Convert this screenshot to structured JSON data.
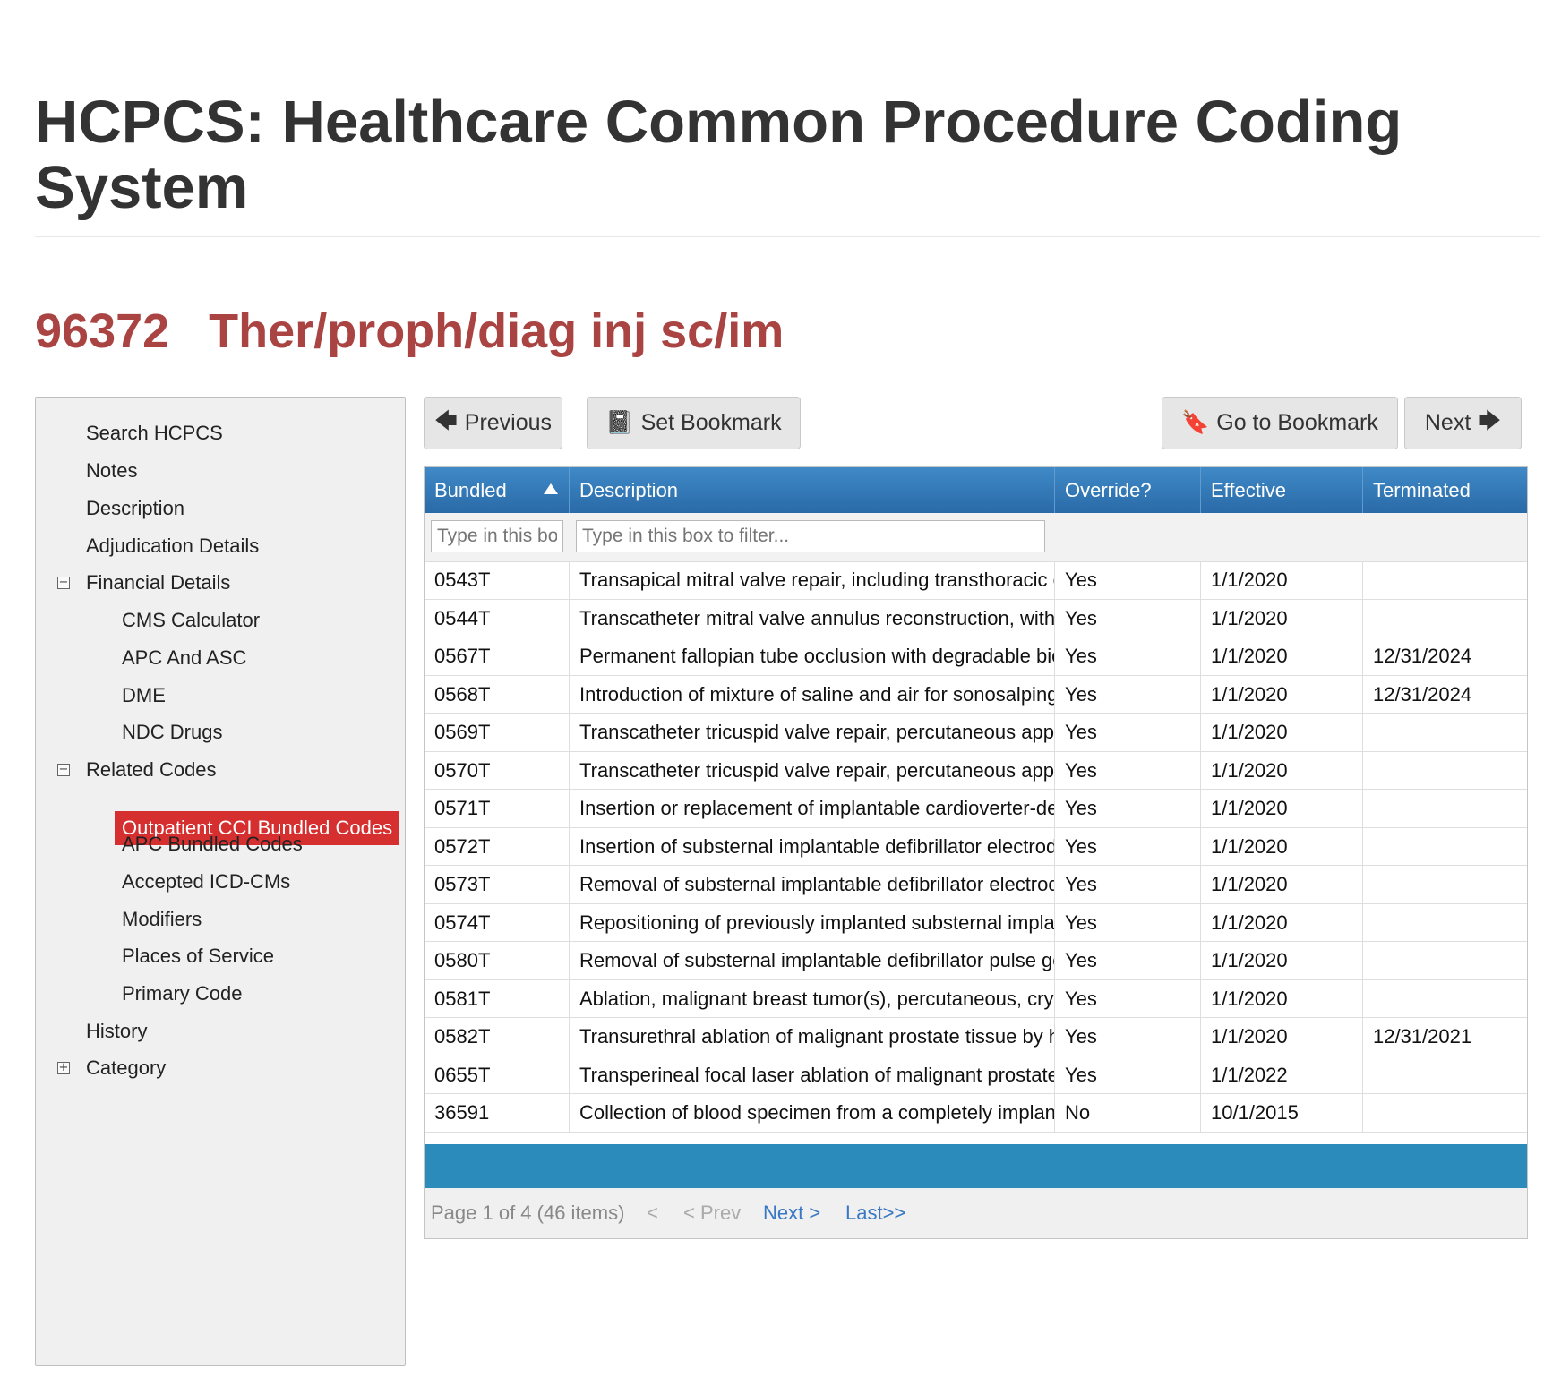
{
  "page": {
    "title": "HCPCS: Healthcare Common Procedure Coding System",
    "code": "96372",
    "code_desc": "Ther/proph/diag inj sc/im"
  },
  "sidebar": {
    "search": "Search HCPCS",
    "notes": "Notes",
    "description": "Description",
    "adjudication": "Adjudication Details",
    "financial": "Financial Details",
    "cms_calc": "CMS Calculator",
    "apc_asc": "APC And ASC",
    "dme": "DME",
    "ndc": "NDC Drugs",
    "related": "Related Codes",
    "outpatient_cci": "Outpatient CCI Bundled Codes",
    "apc_bundled": "APC Bundled Codes",
    "icd": "Accepted ICD-CMs",
    "modifiers": "Modifiers",
    "places": "Places of Service",
    "primary": "Primary Code",
    "history": "History",
    "category": "Category",
    "collapse_symbol": "−",
    "expand_symbol": "+"
  },
  "toolbar": {
    "previous": "Previous",
    "set_bookmark": "Set Bookmark",
    "go_bookmark": "Go to Bookmark",
    "next": "Next",
    "icons": {
      "arrow_left": "🡄",
      "book": "📓",
      "bookmark": "🔖",
      "arrow_right": "🡆"
    }
  },
  "grid": {
    "columns": [
      "Bundled",
      "Description",
      "Override?",
      "Effective",
      "Terminated"
    ],
    "filter_placeholder_bundled": "Type in this box to filter...",
    "filter_placeholder_desc": "Type in this box to filter...",
    "rows": [
      [
        "0543T",
        "Transapical mitral valve repair, including transthoracic echocardiography",
        "Yes",
        "1/1/2020",
        ""
      ],
      [
        "0544T",
        "Transcatheter mitral valve annulus reconstruction, with implantation",
        "Yes",
        "1/1/2020",
        ""
      ],
      [
        "0567T",
        "Permanent fallopian tube occlusion with degradable biopolymer implant",
        "Yes",
        "1/1/2020",
        "12/31/2024"
      ],
      [
        "0568T",
        "Introduction of mixture of saline and air for sonosalpingography",
        "Yes",
        "1/1/2020",
        "12/31/2024"
      ],
      [
        "0569T",
        "Transcatheter tricuspid valve repair, percutaneous approach",
        "Yes",
        "1/1/2020",
        ""
      ],
      [
        "0570T",
        "Transcatheter tricuspid valve repair, percutaneous approach",
        "Yes",
        "1/1/2020",
        ""
      ],
      [
        "0571T",
        "Insertion or replacement of implantable cardioverter-defibrillator",
        "Yes",
        "1/1/2020",
        ""
      ],
      [
        "0572T",
        "Insertion of substernal implantable defibrillator electrode",
        "Yes",
        "1/1/2020",
        ""
      ],
      [
        "0573T",
        "Removal of substernal implantable defibrillator electrode",
        "Yes",
        "1/1/2020",
        ""
      ],
      [
        "0574T",
        "Repositioning of previously implanted substernal implantable",
        "Yes",
        "1/1/2020",
        ""
      ],
      [
        "0580T",
        "Removal of substernal implantable defibrillator pulse generator",
        "Yes",
        "1/1/2020",
        ""
      ],
      [
        "0581T",
        "Ablation, malignant breast tumor(s), percutaneous, cryotherapy",
        "Yes",
        "1/1/2020",
        ""
      ],
      [
        "0582T",
        "Transurethral ablation of malignant prostate tissue by high-energy",
        "Yes",
        "1/1/2020",
        "12/31/2021"
      ],
      [
        "0655T",
        "Transperineal focal laser ablation of malignant prostate tissue",
        "Yes",
        "1/1/2022",
        ""
      ],
      [
        "36591",
        "Collection of blood specimen from a completely implantable",
        "No",
        "10/1/2015",
        ""
      ]
    ]
  },
  "pager": {
    "info": "Page 1 of 4 (46 items)",
    "first": "<",
    "prev": "< Prev",
    "next": "Next >",
    "last": "Last>>"
  },
  "colors": {
    "heading_red": "#a94442",
    "active_red": "#d62f2f",
    "header_blue": "#2a6aa8",
    "footer_blue": "#2b8bbb"
  }
}
